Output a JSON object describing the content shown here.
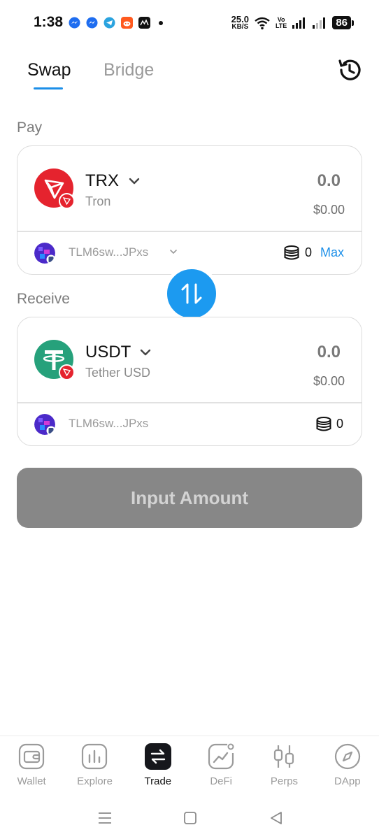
{
  "status_bar": {
    "time": "1:38",
    "net_speed_value": "25.0",
    "net_speed_unit": "KB/S",
    "volte_top": "Vo",
    "volte_bottom": "LTE",
    "battery": "86"
  },
  "tabs": [
    {
      "label": "Swap",
      "active": true
    },
    {
      "label": "Bridge",
      "active": false
    }
  ],
  "pay": {
    "section_label": "Pay",
    "token_symbol": "TRX",
    "token_name": "Tron",
    "amount": "0.0",
    "fiat_value": "$0.00",
    "wallet_address": "TLM6sw...JPxs",
    "balance": "0",
    "max_label": "Max"
  },
  "receive": {
    "section_label": "Receive",
    "token_symbol": "USDT",
    "token_name": "Tether USD",
    "amount": "0.0",
    "fiat_value": "$0.00",
    "wallet_address": "TLM6sw...JPxs",
    "balance": "0"
  },
  "submit_label": "Input Amount",
  "bottom_nav": [
    {
      "label": "Wallet",
      "icon": "wallet-icon"
    },
    {
      "label": "Explore",
      "icon": "chart-icon"
    },
    {
      "label": "Trade",
      "icon": "swap-arrows-icon",
      "active": true
    },
    {
      "label": "DeFi",
      "icon": "trend-icon"
    },
    {
      "label": "Perps",
      "icon": "candlestick-icon"
    },
    {
      "label": "DApp",
      "icon": "compass-icon"
    }
  ],
  "colors": {
    "accent": "#1c8fe8",
    "trx_red": "#e5232e",
    "usdt_green": "#26a17b",
    "button_disabled": "#878787"
  }
}
